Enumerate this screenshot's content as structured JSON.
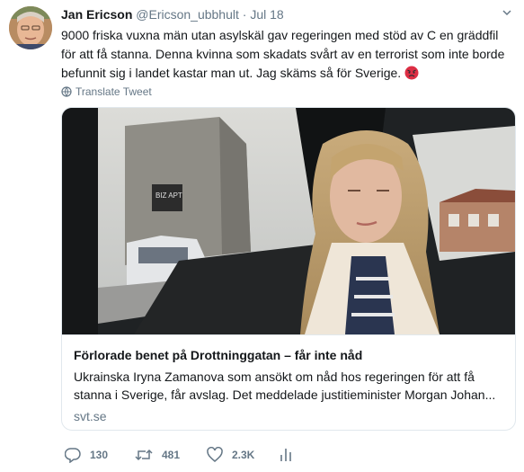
{
  "tweet": {
    "author_name": "Jan Ericson",
    "handle": "@Ericson_ubbhult",
    "separator": "·",
    "time": "Jul 18",
    "text": "9000 friska vuxna män utan asylskäl gav regeringen med stöd av C en gräddfil för att få stanna. Denna kvinna som skadats svårt av en terrorist som inte borde befunnit sig i landet kastar man ut. Jag skäms så för Sverige.",
    "emoji_icon": "angry-face-icon",
    "translate_label": "Translate Tweet"
  },
  "card": {
    "title": "Förlorade benet på Drottninggatan – får inte nåd",
    "description": "Ukrainska Iryna Zamanova som ansökt om nåd hos regeringen för att få stanna i Sverige, får avslag. Det meddelade justitieminister Morgan Johan...",
    "domain": "svt.se",
    "image_sign_text": "BIZ APT"
  },
  "actions": {
    "replies": "130",
    "retweets": "481",
    "likes": "2.3K",
    "icons": [
      "reply-icon",
      "retweet-icon",
      "like-icon",
      "analytics-icon"
    ]
  },
  "colors": {
    "text": "#14171a",
    "secondary": "#657786",
    "border": "#e1e8ed"
  }
}
